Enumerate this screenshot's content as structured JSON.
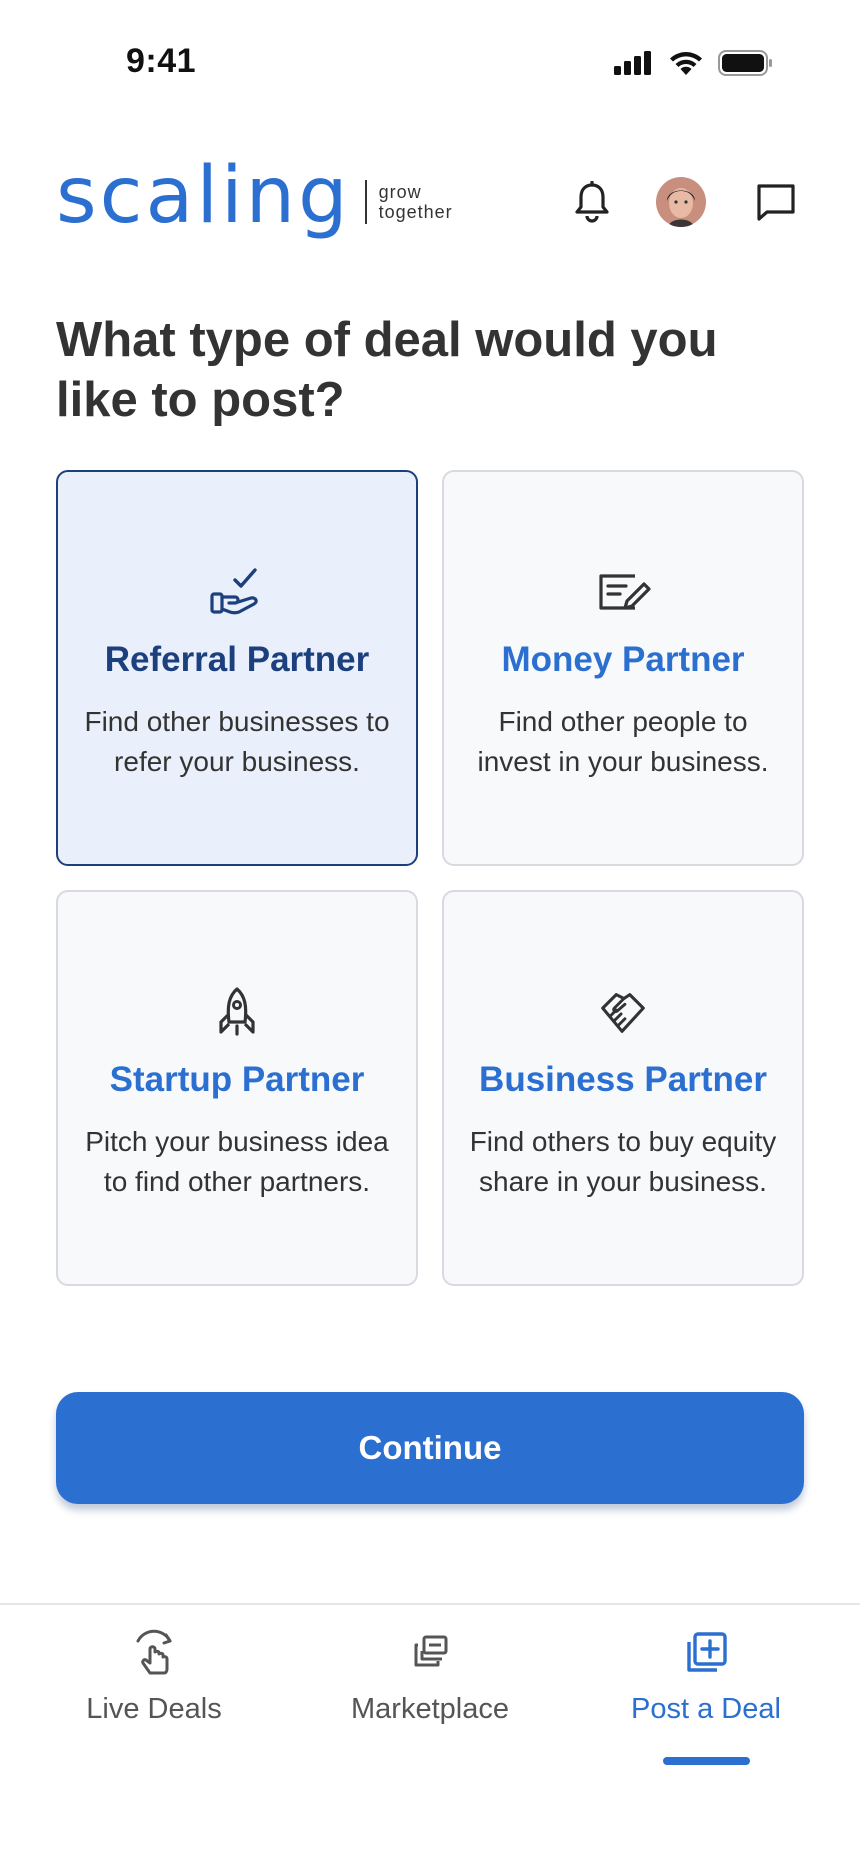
{
  "status_bar": {
    "time": "9:41",
    "icons": [
      "cellular-signal-icon",
      "wifi-icon",
      "battery-icon"
    ]
  },
  "header": {
    "logo_text": "scaling",
    "tagline_line1": "grow",
    "tagline_line2": "together",
    "icons": [
      "bell-icon",
      "avatar",
      "chat-icon"
    ]
  },
  "page": {
    "title": "What type of deal would you like to post?"
  },
  "deal_types": [
    {
      "title": "Referral Partner",
      "description": "Find other businesses to refer your business.",
      "icon": "hand-check-icon",
      "selected": true
    },
    {
      "title": "Money Partner",
      "description": "Find other people to invest in your business.",
      "icon": "signed-document-icon",
      "selected": false
    },
    {
      "title": "Startup Partner",
      "description": "Pitch your business idea to find other partners.",
      "icon": "rocket-icon",
      "selected": false
    },
    {
      "title": "Business Partner",
      "description": "Find others to buy equity share in your business.",
      "icon": "handshake-icon",
      "selected": false
    }
  ],
  "continue_label": "Continue",
  "bottom_nav": {
    "items": [
      {
        "label": "Live Deals",
        "icon": "live-deals-icon",
        "active": false
      },
      {
        "label": "Marketplace",
        "icon": "marketplace-icon",
        "active": false
      },
      {
        "label": "Post a Deal",
        "icon": "post-deal-icon",
        "active": true
      }
    ]
  },
  "colors": {
    "accent": "#2B6FD1",
    "selected_border": "#1C3F7E",
    "selected_bg": "#EAF0FB",
    "card_bg": "#F8F9FB",
    "text": "#333333"
  }
}
